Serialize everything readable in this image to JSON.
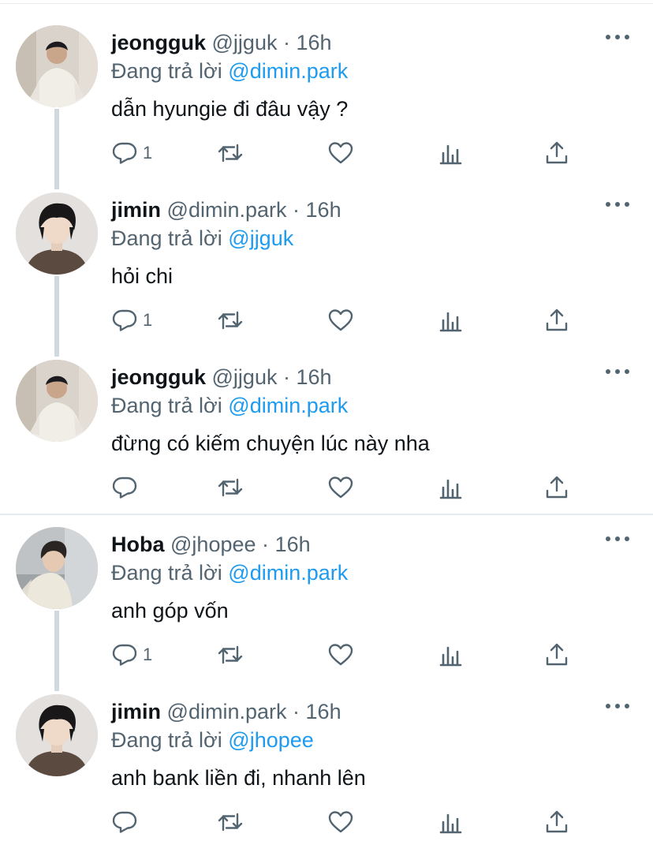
{
  "reply_prefix": "Đang trả lời",
  "colors": {
    "link": "#1d9bf0",
    "muted": "#536471",
    "text": "#0f1419",
    "thread_line": "#cfd9de"
  },
  "icons": [
    "reply-icon",
    "retweet-icon",
    "like-icon",
    "views-icon",
    "share-icon",
    "more-icon"
  ],
  "tweets": [
    {
      "name": "jeongguk",
      "handle": "@jjguk",
      "dot": "·",
      "time": "16h",
      "reply_to": "@dimin.park",
      "text": "dẫn hyungie đi đâu vậy ?",
      "reply_count": "1",
      "avatar": "jeongguk"
    },
    {
      "name": "jimin",
      "handle": "@dimin.park",
      "dot": "·",
      "time": "16h",
      "reply_to": "@jjguk",
      "text": "hỏi chi",
      "reply_count": "1",
      "avatar": "jimin"
    },
    {
      "name": "jeongguk",
      "handle": "@jjguk",
      "dot": "·",
      "time": "16h",
      "reply_to": "@dimin.park",
      "text": "đừng có kiếm chuyện lúc này nha",
      "reply_count": "",
      "avatar": "jeongguk"
    },
    {
      "name": "Hoba",
      "handle": "@jhopee",
      "dot": "·",
      "time": "16h",
      "reply_to": "@dimin.park",
      "text": "anh góp vốn",
      "reply_count": "1",
      "avatar": "hoba"
    },
    {
      "name": "jimin",
      "handle": "@dimin.park",
      "dot": "·",
      "time": "16h",
      "reply_to": "@jhopee",
      "text": "anh bank liền đi, nhanh lên",
      "reply_count": "",
      "avatar": "jimin"
    }
  ]
}
